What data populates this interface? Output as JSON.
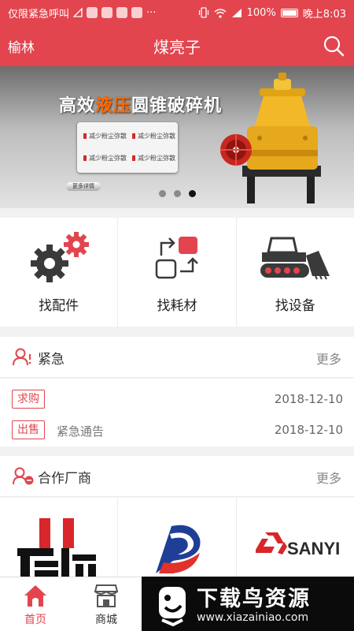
{
  "status_bar": {
    "carrier": "仅限紧急呼叫",
    "icons": [
      "signal-x-icon",
      "app-icon",
      "app-icon",
      "app-icon",
      "app-icon",
      "more-dots-icon"
    ],
    "dots": "···",
    "battery": "100%",
    "time": "晚上8:03"
  },
  "header": {
    "city": "榆林",
    "title": "煤亮子",
    "search_icon": "search-icon"
  },
  "banner": {
    "headline_pre": "高效",
    "headline_highlight": "液压",
    "headline_post": "圆锥破碎机",
    "features": [
      "减少粉尘弥散",
      "减少粉尘弥散",
      "减少粉尘弥散",
      "减少粉尘弥散"
    ],
    "more_button": "更多详情",
    "slides_total": 3,
    "active_slide": 3
  },
  "categories": [
    {
      "label": "找配件",
      "icon": "gears-icon"
    },
    {
      "label": "找耗材",
      "icon": "exchange-icon"
    },
    {
      "label": "找设备",
      "icon": "bulldozer-icon"
    }
  ],
  "urgent": {
    "title": "紧急",
    "more": "更多",
    "items": [
      {
        "tag": "求购",
        "text": "",
        "date": "2018-12-10"
      },
      {
        "tag": "出售",
        "text": "紧急通告",
        "date": "2018-12-10"
      }
    ]
  },
  "partners": {
    "title": "合作厂商",
    "more": "更多",
    "logos": [
      {
        "name": "factory-logo",
        "text": ""
      },
      {
        "name": "blue-red-logo",
        "text": ""
      },
      {
        "name": "sanyi-logo",
        "text": "SANYI"
      }
    ]
  },
  "tabbar": {
    "tabs": [
      {
        "label": "首页",
        "icon": "home-icon",
        "active": true
      },
      {
        "label": "商城",
        "icon": "store-icon",
        "active": false
      }
    ]
  },
  "watermark": {
    "main": "下载鸟资源",
    "url": "www.xiazainiao.com"
  },
  "colors": {
    "brand_red": "#e2454e",
    "text_dark": "#222222",
    "text_muted": "#888888"
  }
}
